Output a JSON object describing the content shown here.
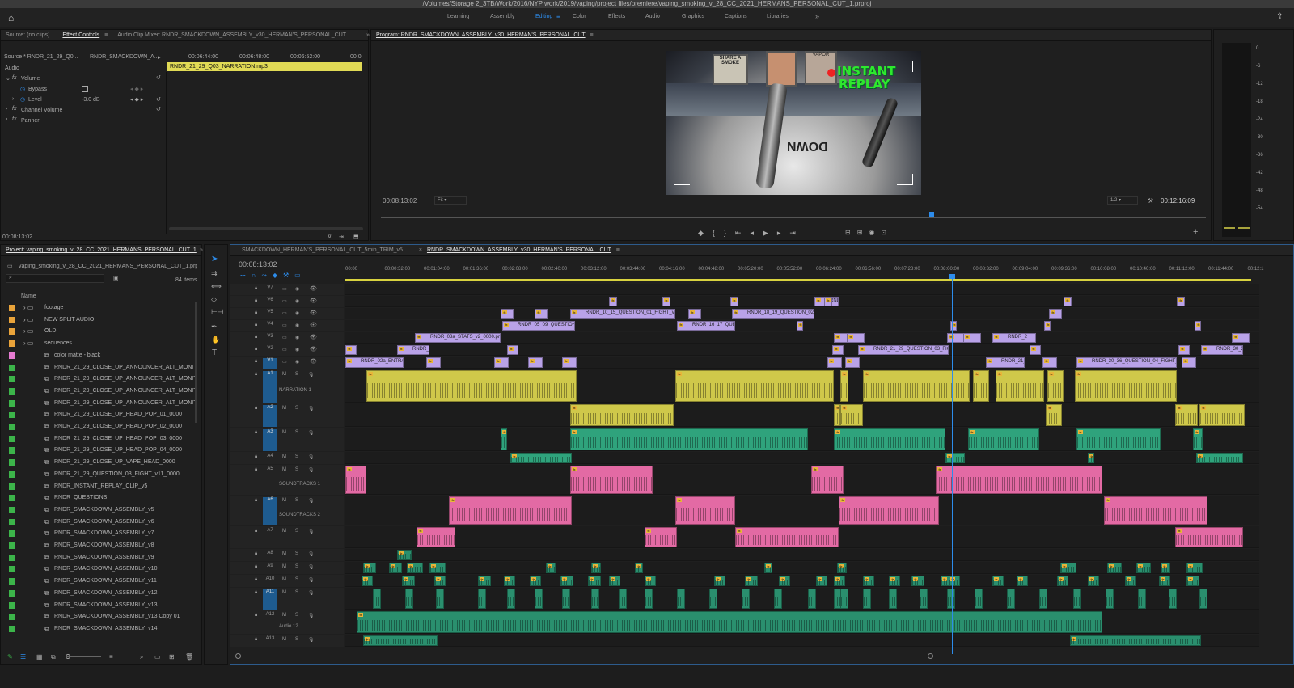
{
  "window_title": "/Volumes/Storage 2_3TB/Work/2016/NYP work/2019/vaping/project files/premiere/vaping_smoking_v_28_CC_2021_HERMANS_PERSONAL_CUT_1.prproj",
  "workspaces": [
    "Learning",
    "Assembly",
    "Editing",
    "Color",
    "Effects",
    "Audio",
    "Graphics",
    "Captions",
    "Libraries"
  ],
  "workspaces_more": "»",
  "source_panel": {
    "tab_source": "Source: (no clips)",
    "tab_effect_controls": "Effect Controls",
    "tab_audio_mixer": "Audio Clip Mixer: RNDR_SMACKDOWN_ASSEMBLY_v30_HERMAN'S_PERSONAL_CUT",
    "source_label": "Source * RNDR_21_29_Q0...",
    "seq_label": "RNDR_SMACKDOWN_A...",
    "times": [
      "00:06:44:00",
      "00:06:48:00",
      "00:06:52:00",
      "00:0"
    ],
    "clip_name": "RNDR_21_29_Q03_NARRATION.mp3",
    "audio_header": "Audio",
    "volume": "Volume",
    "bypass": "Bypass",
    "level": "Level",
    "level_value": "-3.0 dB",
    "channel_volume": "Channel Volume",
    "panner": "Panner",
    "timecode": "00:08:13:02"
  },
  "program": {
    "title": "Program: RNDR_SMACKDOWN_ASSEMBLY_v30_HERMAN'S_PERSONAL_CUT",
    "timecode": "00:08:13:02",
    "fit": "Fit",
    "resolution": "1/2",
    "duration": "00:12:16:09",
    "overlay_line1": "INSTANT",
    "overlay_line2": "REPLAY",
    "ad_text1": "SHARE A SMOKE",
    "ad_text2": "VAPOR",
    "ring_text": "DOWN"
  },
  "meter": {
    "labels": [
      "0",
      "-6",
      "-12",
      "-18",
      "-24",
      "-30",
      "-36",
      "-42",
      "-48",
      "-54"
    ],
    "solo": [
      "S",
      "S"
    ]
  },
  "project": {
    "tab": "Project: vaping_smoking_v_28_CC_2021_HERMANS_PERSONAL_CUT_1",
    "file": "vaping_smoking_v_28_CC_2021_HERMANS_PERSONAL_CUT_1.prproj",
    "count": "84 items",
    "name_header": "Name",
    "items": [
      {
        "name": "footage",
        "color": "#e9a33a",
        "folder": true
      },
      {
        "name": "NEW SPLIT AUDIO",
        "color": "#e9a33a",
        "folder": true
      },
      {
        "name": "OLD",
        "color": "#e9a33a",
        "folder": true
      },
      {
        "name": "sequences",
        "color": "#e9a33a",
        "folder": true
      },
      {
        "name": "color matte - black",
        "color": "#e57ad0",
        "folder": false
      },
      {
        "name": "RNDR_21_29_CLOSE_UP_ANNOUNCER_ALT_MONITC",
        "color": "#3cb54a",
        "folder": false
      },
      {
        "name": "RNDR_21_29_CLOSE_UP_ANNOUNCER_ALT_MONITC",
        "color": "#3cb54a",
        "folder": false
      },
      {
        "name": "RNDR_21_29_CLOSE_UP_ANNOUNCER_ALT_MONITC",
        "color": "#3cb54a",
        "folder": false
      },
      {
        "name": "RNDR_21_29_CLOSE_UP_ANNOUNCER_ALT_MONITC",
        "color": "#3cb54a",
        "folder": false
      },
      {
        "name": "RNDR_21_29_CLOSE_UP_HEAD_POP_01_0000",
        "color": "#3cb54a",
        "folder": false
      },
      {
        "name": "RNDR_21_29_CLOSE_UP_HEAD_POP_02_0000",
        "color": "#3cb54a",
        "folder": false
      },
      {
        "name": "RNDR_21_29_CLOSE_UP_HEAD_POP_03_0000",
        "color": "#3cb54a",
        "folder": false
      },
      {
        "name": "RNDR_21_29_CLOSE_UP_HEAD_POP_04_0000",
        "color": "#3cb54a",
        "folder": false
      },
      {
        "name": "RNDR_21_29_CLOSE_UP_VAPE_HEAD_0000",
        "color": "#3cb54a",
        "folder": false
      },
      {
        "name": "RNDR_21_29_QUESTION_03_FIGHT_v11_0000",
        "color": "#3cb54a",
        "folder": false
      },
      {
        "name": "RNDR_INSTANT_REPLAY_CLIP_v5",
        "color": "#3cb54a",
        "folder": false
      },
      {
        "name": "RNDR_QUESTIONS",
        "color": "#3cb54a",
        "folder": false
      },
      {
        "name": "RNDR_SMACKDOWN_ASSEMBLY_v5",
        "color": "#3cb54a",
        "folder": false
      },
      {
        "name": "RNDR_SMACKDOWN_ASSEMBLY_v6",
        "color": "#3cb54a",
        "folder": false
      },
      {
        "name": "RNDR_SMACKDOWN_ASSEMBLY_v7",
        "color": "#3cb54a",
        "folder": false
      },
      {
        "name": "RNDR_SMACKDOWN_ASSEMBLY_v8",
        "color": "#3cb54a",
        "folder": false
      },
      {
        "name": "RNDR_SMACKDOWN_ASSEMBLY_v9",
        "color": "#3cb54a",
        "folder": false
      },
      {
        "name": "RNDR_SMACKDOWN_ASSEMBLY_v10",
        "color": "#3cb54a",
        "folder": false
      },
      {
        "name": "RNDR_SMACKDOWN_ASSEMBLY_v11",
        "color": "#3cb54a",
        "folder": false
      },
      {
        "name": "RNDR_SMACKDOWN_ASSEMBLY_v12",
        "color": "#3cb54a",
        "folder": false
      },
      {
        "name": "RNDR_SMACKDOWN_ASSEMBLY_v13",
        "color": "#3cb54a",
        "folder": false
      },
      {
        "name": "RNDR_SMACKDOWN_ASSEMBLY_v13 Copy 01",
        "color": "#3cb54a",
        "folder": false
      },
      {
        "name": "RNDR_SMACKDOWN_ASSEMBLY_v14",
        "color": "#3cb54a",
        "folder": false
      }
    ]
  },
  "timeline": {
    "tab1": "SMACKDOWN_HERMAN'S_PERSONAL_CUT_5min_TRIM_v5",
    "tab2": "RNDR_SMACKDOWN_ASSEMBLY_v30_HERMAN'S_PERSONAL_CUT",
    "timecode": "00:08:13:02",
    "ruler": [
      "00:00",
      "00:00:32:00",
      "00:01:04:00",
      "00:01:36:00",
      "00:02:08:00",
      "00:02:40:00",
      "00:03:12:00",
      "00:03:44:00",
      "00:04:16:00",
      "00:04:48:00",
      "00:05:20:00",
      "00:05:52:00",
      "00:06:24:00",
      "00:06:56:00",
      "00:07:28:00",
      "00:08:00:00",
      "00:08:32:00",
      "00:09:04:00",
      "00:09:36:00",
      "00:10:08:00",
      "00:10:40:00",
      "00:11:12:00",
      "00:11:44:00",
      "00:12:1"
    ],
    "track_names": {
      "v1": "V1",
      "a1": "A1",
      "a6": "A6",
      "a11": "A11"
    },
    "track_labels": {
      "a1": "NARRATION 1",
      "a5": "SOUNDTRACKS 1",
      "a6": "SOUNDTRACKS 2",
      "a12": "Audio 12"
    },
    "clip_labels": {
      "v5a": "RNDR_10_15_QUESTION_01_FIGHT_v8_00",
      "v5b": "RNDR_18_19_QUESTION_02_F",
      "v4a": "RNDR_05_09_QUESTION_0",
      "v4b": "RNDR_16_17_QUEST",
      "v3a": "RNDR_03a_STATS_v2_0000.png",
      "v3b": "RNDR_2",
      "v2a": "RNDR_",
      "v2b": "RNDR_21_29_QUESTION_03_FIGH",
      "v2c": "RND",
      "v2d": "RNDR_30_36",
      "v1a": "RNDR_02a_ENTRAN",
      "v1b": "RNDR_21_2",
      "v1c": "RNDR_30_36_QUESTION_04_FIGHT_v20",
      "v6a": "RND"
    }
  },
  "colors": {
    "accent_blue": "#2d8ceb",
    "video_clip": "#b9a2e8",
    "narration": "#cfc84a",
    "audio_green": "#2fa37c",
    "soundtrack": "#e36aa4"
  }
}
